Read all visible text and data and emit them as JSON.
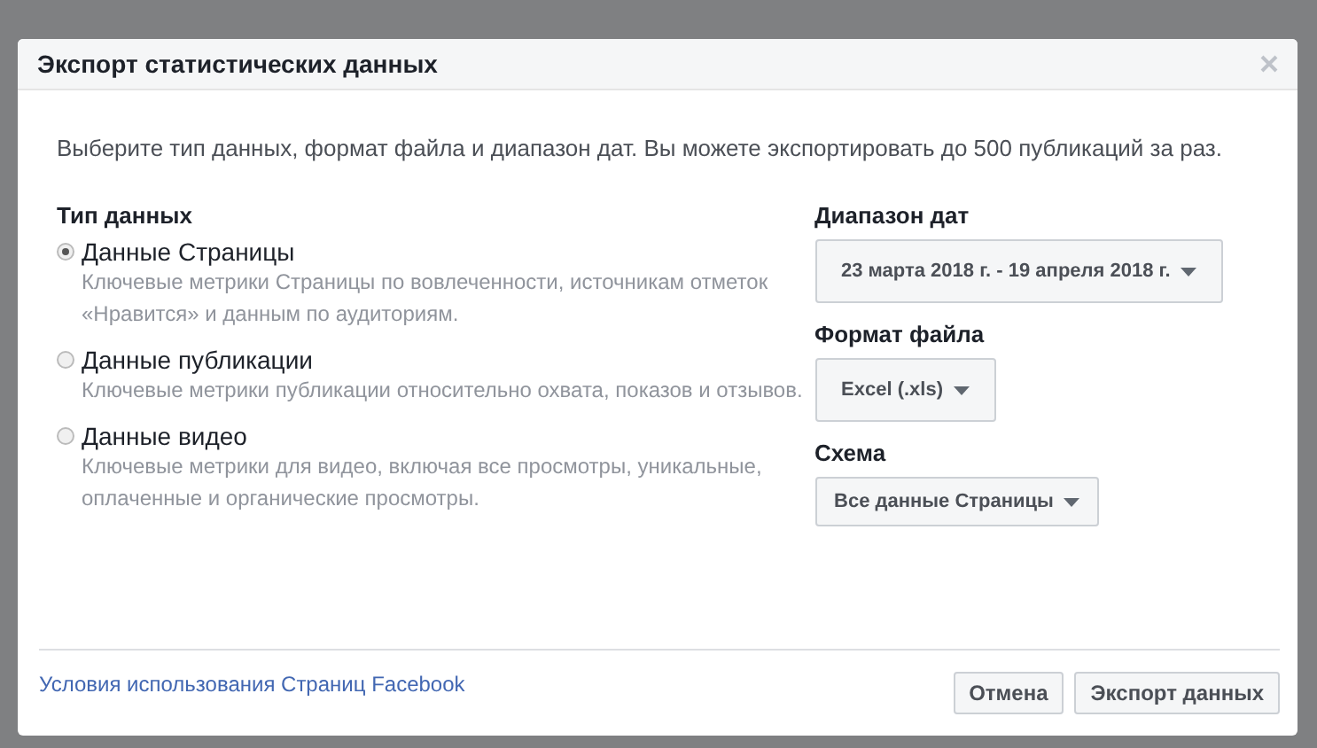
{
  "dialog": {
    "title": "Экспорт статистических данных",
    "intro": "Выберите тип данных, формат файла и диапазон дат. Вы можете экспортировать до 500 публикаций за раз.",
    "data_type": {
      "heading": "Тип данных",
      "options": [
        {
          "label": "Данные Страницы",
          "description": "Ключевые метрики Страницы по вовлеченности, источникам отметок «Нравится» и данным по аудиториям.",
          "selected": true
        },
        {
          "label": "Данные публикации",
          "description": "Ключевые метрики публикации относительно охвата, показов и отзывов.",
          "selected": false
        },
        {
          "label": "Данные видео",
          "description": "Ключевые метрики для видео, включая все просмотры, уникальные, оплаченные и органические просмотры.",
          "selected": false
        }
      ]
    },
    "settings": [
      {
        "heading": "Диапазон дат",
        "value": "23 марта 2018 г. - 19 апреля 2018 г."
      },
      {
        "heading": "Формат файла",
        "value": "Excel (.xls)"
      },
      {
        "heading": "Схема",
        "value": "Все данные Страницы"
      }
    ],
    "footer_link": "Условия использования Страниц Facebook",
    "buttons": [
      "Отмена",
      "Экспорт данных"
    ]
  }
}
